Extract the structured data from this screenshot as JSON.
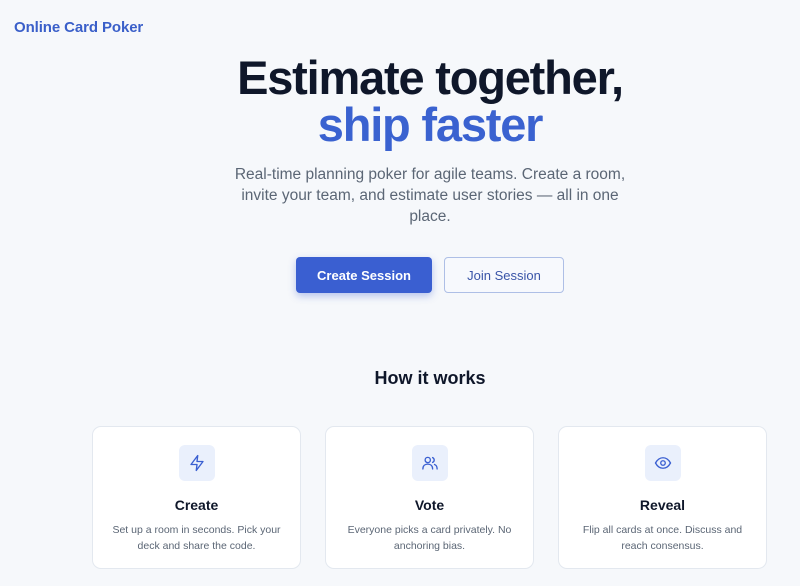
{
  "brand": {
    "name": "Online Card Poker"
  },
  "hero": {
    "headline_line1": "Estimate together,",
    "headline_line2": "ship faster",
    "subtitle": "Real-time planning poker for agile teams. Create a room, invite your team, and estimate user stories — all in one place."
  },
  "actions": {
    "create_label": "Create Session",
    "join_label": "Join Session"
  },
  "how_it_works": {
    "title": "How it works",
    "steps": [
      {
        "icon": "lightning-icon",
        "title": "Create",
        "description": "Set up a room in seconds. Pick your deck and share the code."
      },
      {
        "icon": "users-icon",
        "title": "Vote",
        "description": "Everyone picks a card privately. No anchoring bias."
      },
      {
        "icon": "eye-icon",
        "title": "Reveal",
        "description": "Flip all cards at once. Discuss and reach consensus."
      }
    ]
  },
  "colors": {
    "accent": "#3a5fd1",
    "background": "#f6f8fb",
    "text": "#0f172a",
    "muted": "#5b6675"
  }
}
